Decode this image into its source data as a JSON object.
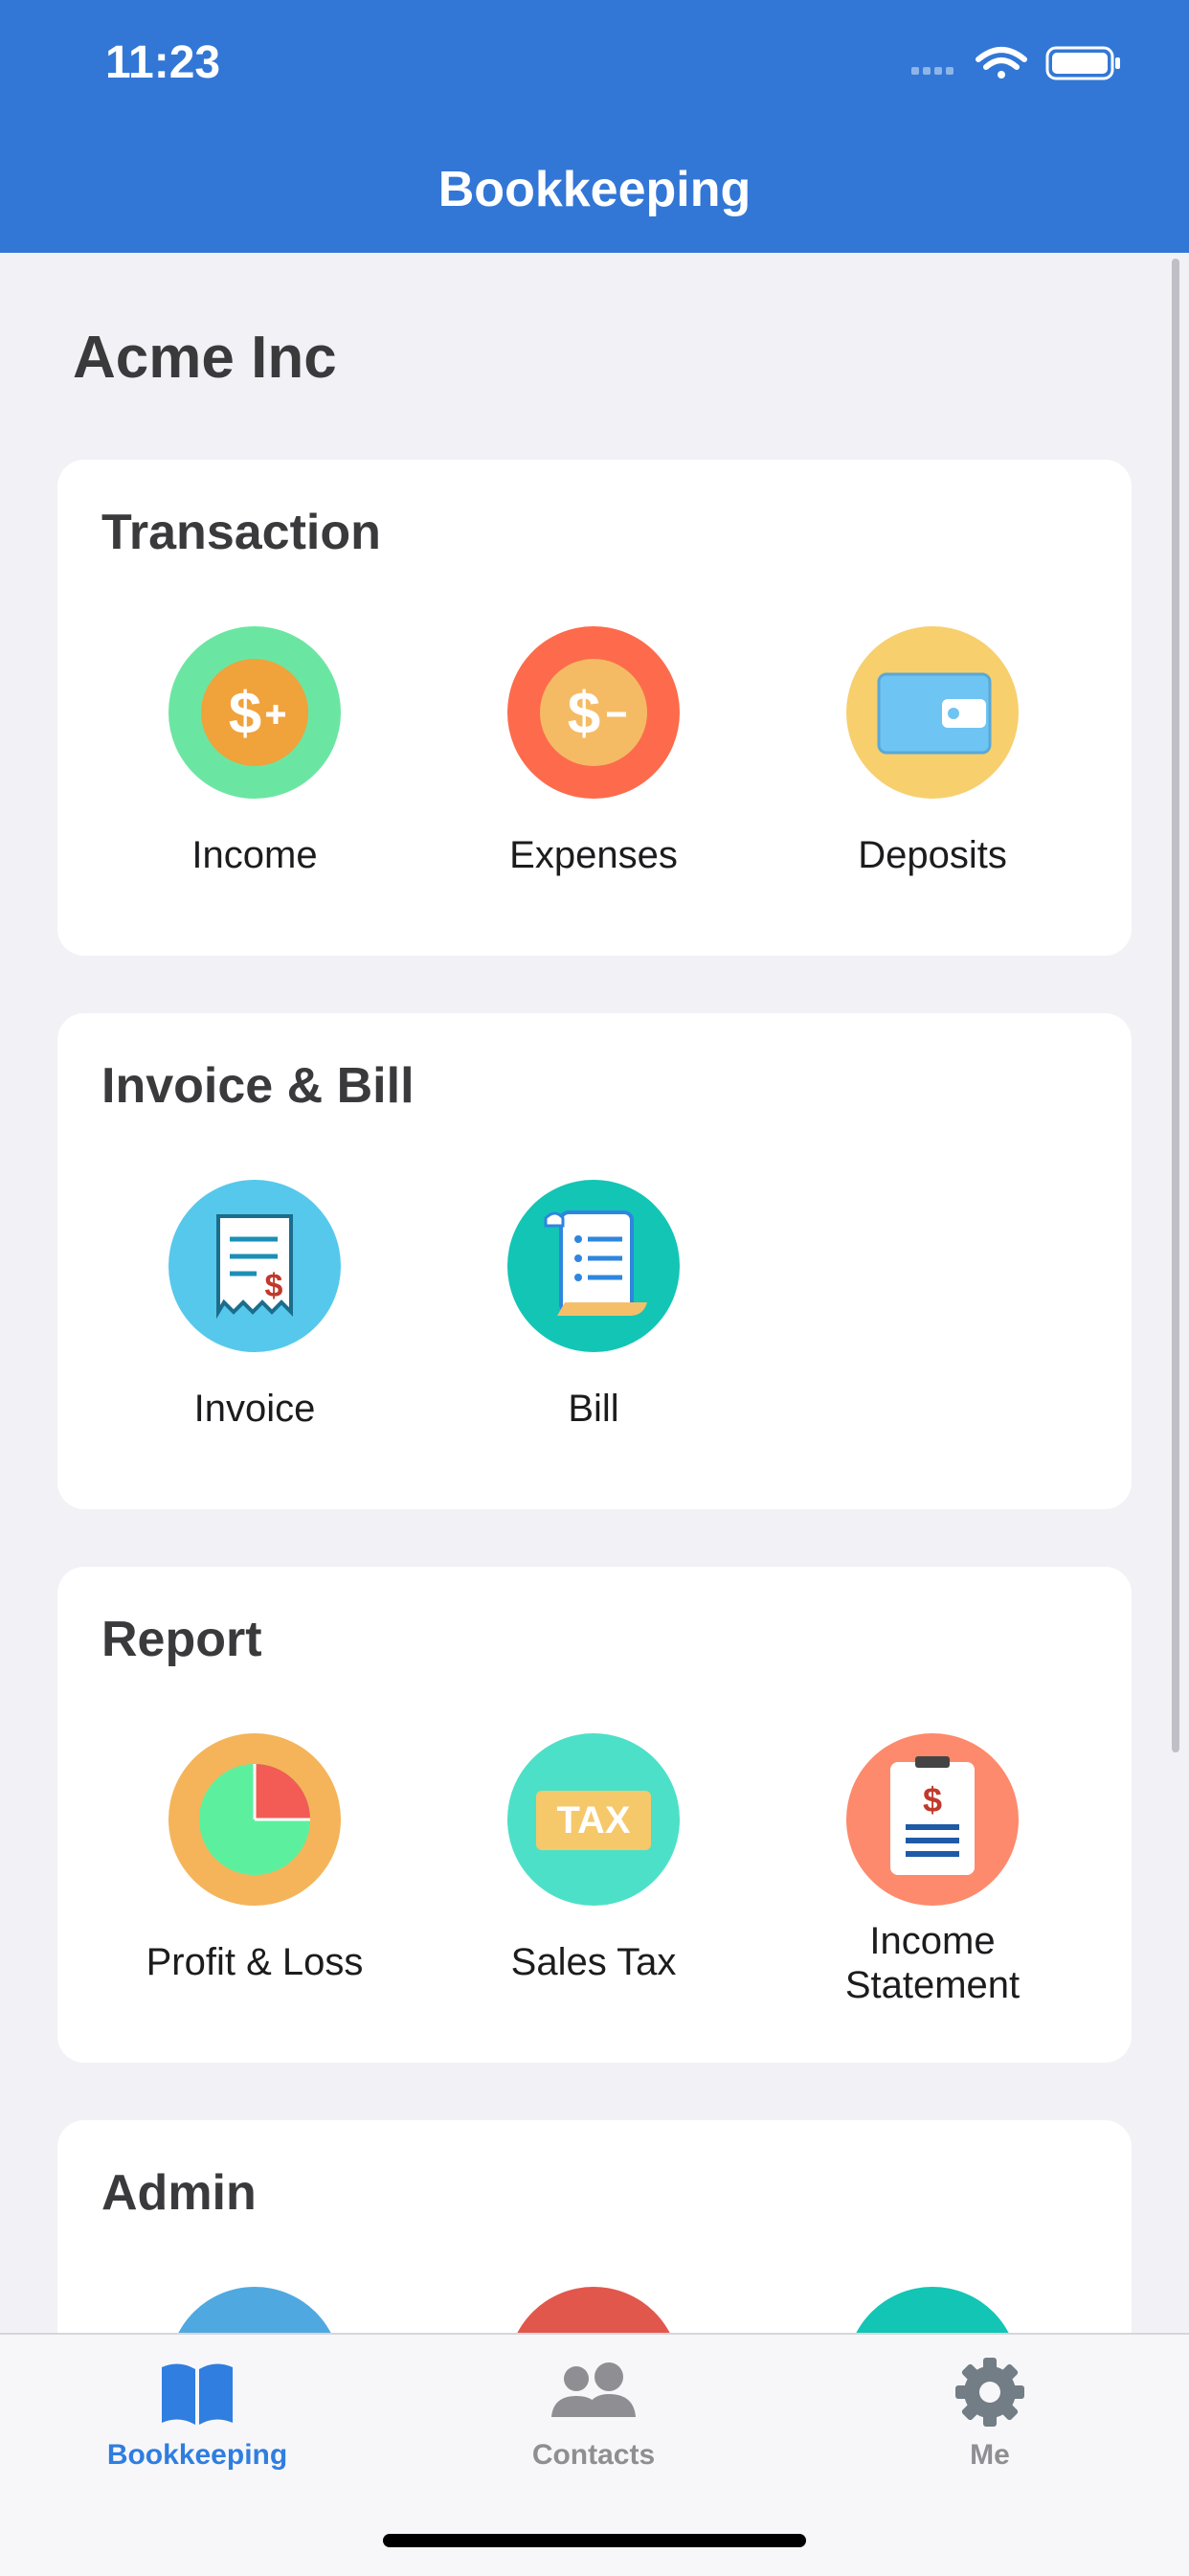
{
  "status_bar": {
    "time": "11:23"
  },
  "header": {
    "title": "Bookkeeping"
  },
  "company": {
    "name": "Acme Inc"
  },
  "sections": {
    "transaction": {
      "title": "Transaction",
      "items": [
        {
          "label": "Income",
          "icon": "income-dollar-plus-icon"
        },
        {
          "label": "Expenses",
          "icon": "expenses-dollar-minus-icon"
        },
        {
          "label": "Deposits",
          "icon": "wallet-icon"
        }
      ]
    },
    "invoice_bill": {
      "title": "Invoice & Bill",
      "items": [
        {
          "label": "Invoice",
          "icon": "invoice-receipt-icon"
        },
        {
          "label": "Bill",
          "icon": "bill-scroll-icon"
        }
      ]
    },
    "report": {
      "title": "Report",
      "items": [
        {
          "label": "Profit & Loss",
          "icon": "pie-chart-icon"
        },
        {
          "label": "Sales Tax",
          "icon": "tax-tag-icon",
          "text": "TAX"
        },
        {
          "label": "Income\nStatement",
          "label_line1": "Income",
          "label_line2": "Statement",
          "icon": "clipboard-dollar-icon"
        }
      ]
    },
    "admin": {
      "title": "Admin"
    }
  },
  "tabbar": {
    "tabs": [
      {
        "label": "Bookkeeping",
        "icon": "open-book-icon",
        "active": true
      },
      {
        "label": "Contacts",
        "icon": "people-icon",
        "active": false
      },
      {
        "label": "Me",
        "icon": "gear-icon",
        "active": false
      }
    ]
  },
  "colors": {
    "header": "#3277d6",
    "active_tab": "#2f7ee0",
    "inactive_tab": "#8e8e93"
  }
}
